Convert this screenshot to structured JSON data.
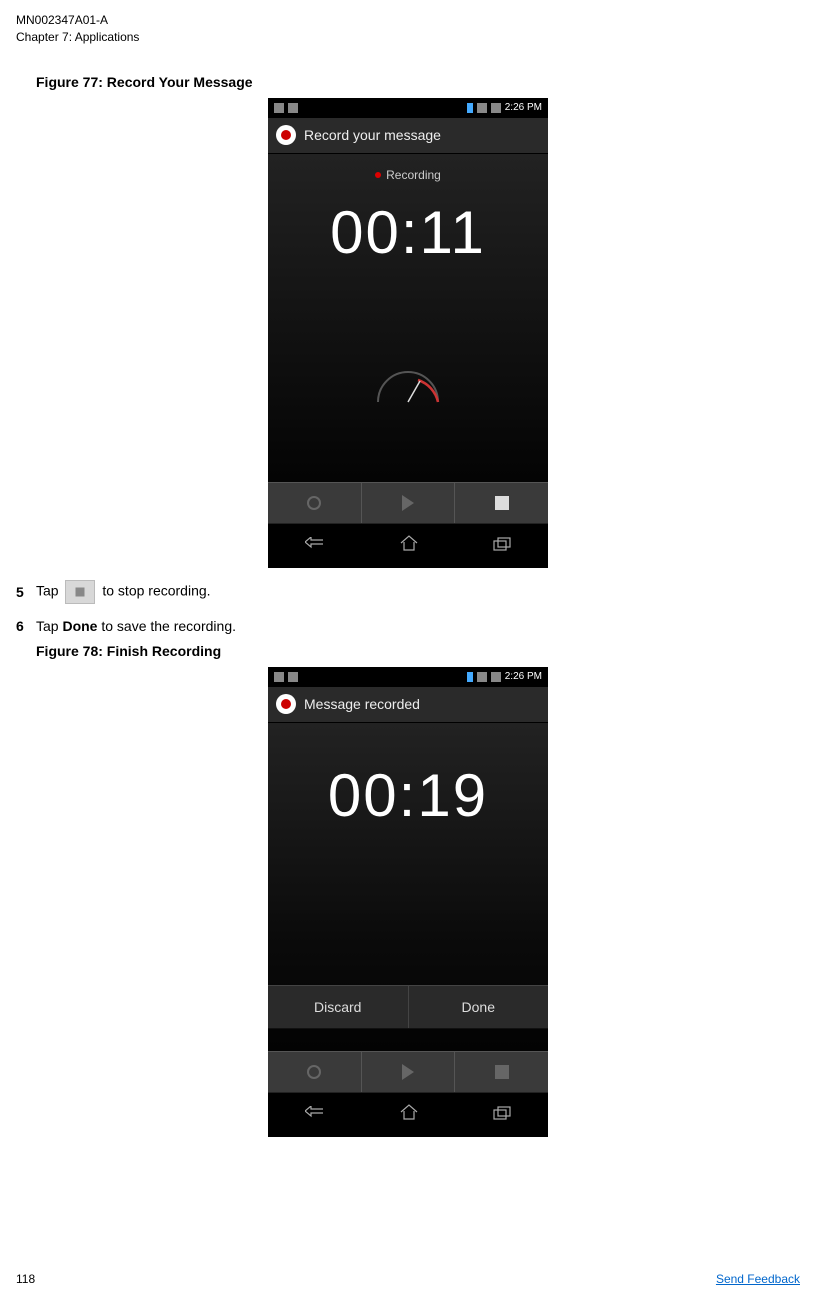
{
  "header": {
    "doc_id": "MN002347A01-A",
    "chapter": "Chapter 7:  Applications"
  },
  "figure77": {
    "caption": "Figure 77: Record Your Message",
    "status_time": "2:26 PM",
    "app_title": "Record your message",
    "recording_label": "Recording",
    "timer": "00:11"
  },
  "steps": {
    "s5_num": "5",
    "s5_pre": "Tap ",
    "s5_post": " to stop recording.",
    "s6_num": "6",
    "s6_pre": "Tap ",
    "s6_bold": "Done",
    "s6_post": " to save the recording."
  },
  "figure78": {
    "caption": "Figure 78: Finish Recording",
    "status_time": "2:26 PM",
    "app_title": "Message recorded",
    "timer": "00:19",
    "discard_label": "Discard",
    "done_label": "Done"
  },
  "footer": {
    "page": "118",
    "feedback": "Send Feedback"
  }
}
